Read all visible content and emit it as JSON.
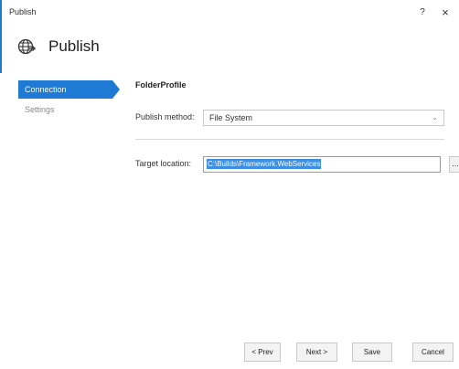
{
  "window": {
    "title": "Publish",
    "help_label": "?",
    "close_label": "×"
  },
  "header": {
    "title": "Publish",
    "icon": "globe-arrow-icon"
  },
  "sidebar": {
    "items": [
      {
        "label": "Connection",
        "active": true
      },
      {
        "label": "Settings",
        "active": false
      }
    ]
  },
  "connection": {
    "profile_name": "FolderProfile",
    "publish_method_label": "Publish method:",
    "publish_method_value": "File System",
    "target_location_label": "Target location:",
    "target_location_value": "C:\\Builds\\Framework.WebServices",
    "browse_label": "..."
  },
  "footer": {
    "prev_label": "< Prev",
    "next_label": "Next >",
    "save_label": "Save",
    "cancel_label": "Cancel"
  },
  "colors": {
    "accent": "#1e7ad4",
    "selection": "#3d8ee3"
  }
}
